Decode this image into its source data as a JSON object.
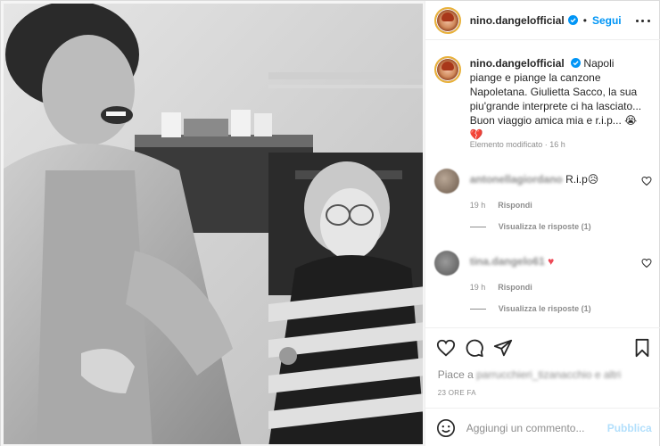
{
  "header": {
    "username": "nino.dangelofficial",
    "follow_label": "Segui"
  },
  "caption": {
    "username": "nino.dangelofficial",
    "text": "Napoli piange e piange la canzone Napoletana. Giulietta Sacco, la sua piu'grande interprete ci ha lasciato... Buon viaggio amica mia e r.i.p...",
    "emoji": "😭 💔",
    "edited_label": "Elemento modificato · 16 h"
  },
  "comments": [
    {
      "username": "antonellagiordano",
      "text": "R.i.p😥",
      "time": "19 h",
      "reply_label": "Rispondi",
      "view_replies": "Visualizza le risposte (1)"
    },
    {
      "username": "tina.dangelo61",
      "text": "♥",
      "time": "19 h",
      "reply_label": "Rispondi",
      "view_replies": "Visualizza le risposte (1)"
    }
  ],
  "likes": {
    "prefix": "Piace a",
    "blurred_name": "parrucchieri_tizanacchio e altri"
  },
  "timestamp": "23 ORE FA",
  "add_comment": {
    "placeholder": "Aggiungi un commento...",
    "publish_label": "Pubblica"
  },
  "colors": {
    "accent": "#0095f6",
    "publish_disabled": "#b2dffc",
    "heart": "#ed4956",
    "muted": "#8e8e8e"
  },
  "icons": [
    "verified-icon",
    "more-icon",
    "heart-icon",
    "comment-icon",
    "share-icon",
    "bookmark-icon",
    "emoji-icon"
  ]
}
